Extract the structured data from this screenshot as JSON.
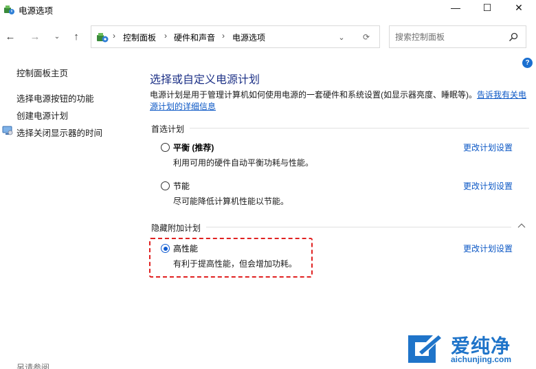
{
  "window": {
    "title": "电源选项",
    "minimize_glyph": "—",
    "maximize_glyph": "☐",
    "close_glyph": "✕"
  },
  "nav": {
    "back_glyph": "←",
    "forward_glyph": "→",
    "recent_glyph": "⌄",
    "up_glyph": "↑"
  },
  "address_bar": {
    "breadcrumbs": [
      "控制面板",
      "硬件和声音",
      "电源选项"
    ],
    "separator": "›",
    "dropdown_glyph": "⌄",
    "refresh_glyph": "⟳"
  },
  "search": {
    "placeholder": "搜索控制面板",
    "value": ""
  },
  "left_pane": {
    "home_link": "控制面板主页",
    "links": [
      "选择电源按钮的功能",
      "创建电源计划",
      "选择关闭显示器的时间"
    ],
    "footer": "另请参阅"
  },
  "help": {
    "glyph": "?"
  },
  "main": {
    "title": "选择或自定义电源计划",
    "description": "电源计划是用于管理计算机如何使用电源的一套硬件和系统设置(如显示器亮度、睡眠等)。",
    "description_link": "告诉我有关电源计划的详细信息",
    "preferred_group": "首选计划",
    "hidden_group": "隐藏附加计划",
    "plans": [
      {
        "name": "平衡",
        "tag": "(推荐)",
        "desc": "利用可用的硬件自动平衡功耗与性能。",
        "link": "更改计划设置",
        "selected": false
      },
      {
        "name": "节能",
        "tag": "",
        "desc": "尽可能降低计算机性能以节能。",
        "link": "更改计划设置",
        "selected": false
      },
      {
        "name": "高性能",
        "tag": "",
        "desc": "有利于提高性能，但会增加功耗。",
        "link": "更改计划设置",
        "selected": true
      }
    ]
  },
  "watermark": {
    "name": "爱纯净",
    "url": "aichunjing.com"
  },
  "colors": {
    "title_blue": "#1e3287",
    "link_blue": "#0b57c5",
    "radio_selected": "#0f5bd1",
    "highlight_red": "#e02020",
    "watermark_blue": "#1f74c9"
  },
  "icons": {
    "app": "power-options-icon",
    "address": "control-panel-icon",
    "search": "search-icon",
    "monitor": "monitor-icon",
    "collapse": "chevron-up-icon",
    "watermark": "watermark-logo-icon"
  }
}
